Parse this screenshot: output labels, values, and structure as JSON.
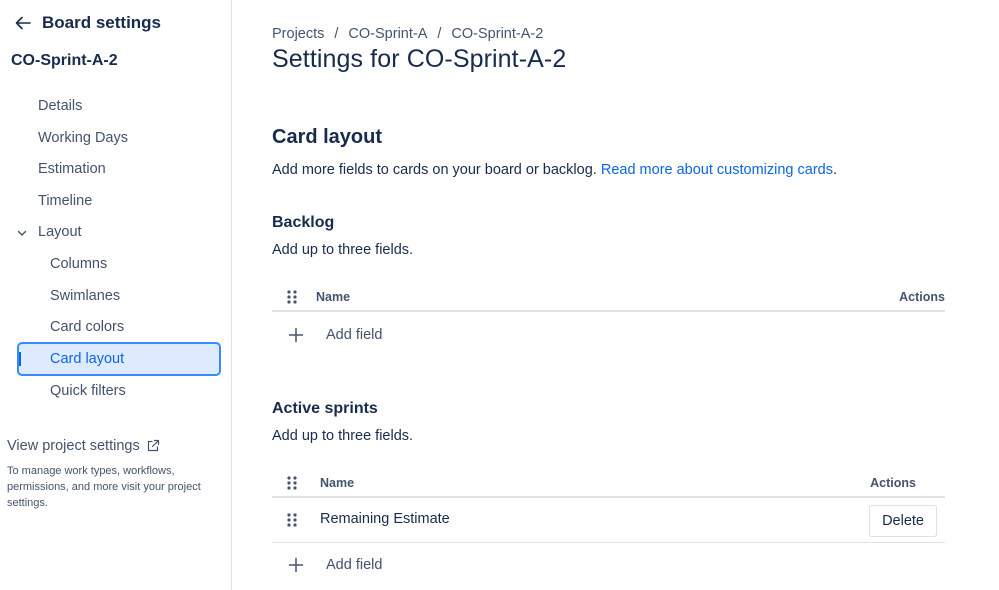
{
  "sidebar": {
    "title": "Board settings",
    "board_name": "CO-Sprint-A-2",
    "nav": {
      "details": "Details",
      "working_days": "Working Days",
      "estimation": "Estimation",
      "timeline": "Timeline",
      "layout": "Layout",
      "columns": "Columns",
      "swimlanes": "Swimlanes",
      "card_colors": "Card colors",
      "card_layout": "Card layout",
      "quick_filters": "Quick filters"
    },
    "selected_item": "Card layout",
    "view_project_settings": "View project settings",
    "project_note": "To manage work types, workflows, permissions, and more visit your project settings."
  },
  "breadcrumb": [
    "Projects",
    "CO-Sprint-A",
    "CO-Sprint-A-2"
  ],
  "breadcrumb_separator": "/",
  "page_title": "Settings for CO-Sprint-A-2",
  "card_layout": {
    "title": "Card layout",
    "description": "Add more fields to cards on your board or backlog.",
    "link_text": "Read more about customizing cards",
    "link_suffix": "."
  },
  "backlog": {
    "title": "Backlog",
    "description": "Add up to three fields.",
    "col_name": "Name",
    "col_actions": "Actions",
    "add_field": "Add field"
  },
  "active_sprints": {
    "title": "Active sprints",
    "description": "Add up to three fields.",
    "col_name": "Name",
    "col_actions": "Actions",
    "rows": [
      {
        "name": "Remaining Estimate",
        "action": "Delete"
      }
    ],
    "add_field": "Add field"
  },
  "colors": {
    "link": "#0c66e4",
    "selected_bg": "#deebff",
    "selected_border": "#388bff",
    "text": "#172b4d"
  },
  "icons": {
    "back": "arrow-left-icon",
    "chevron": "chevron-down-icon",
    "external": "external-link-icon",
    "drag": "drag-handle-icon",
    "add": "plus-icon"
  }
}
